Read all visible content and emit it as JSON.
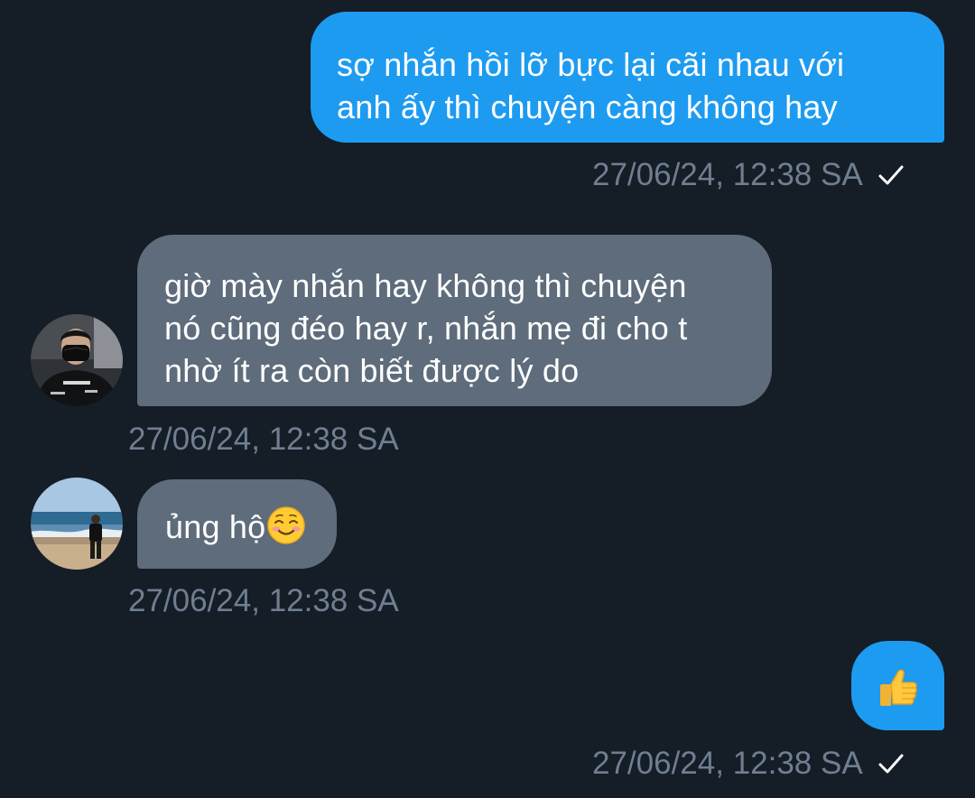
{
  "messages": [
    {
      "sender": "me",
      "lines": [
        "sợ nhắn hồi lỡ bực lại cãi nhau với",
        "anh ấy thì chuyện càng không hay"
      ],
      "time": "27/06/24, 12:38 SA",
      "status_icon": "check-icon"
    },
    {
      "sender": "other",
      "lines": [
        "giờ mày nhắn hay không thì chuyện",
        "nó cũng đéo hay r, nhắn mẹ đi cho t",
        "nhờ ít ra còn biết được lý do"
      ],
      "time": "27/06/24, 12:38 SA",
      "avatar_icon": "avatar-masked-person"
    },
    {
      "sender": "other",
      "text": "ủng hộ",
      "emoji_icon": "smiling-face-emoji",
      "time": "27/06/24, 12:38 SA",
      "avatar_icon": "avatar-beach-person"
    },
    {
      "sender": "me",
      "emoji_icon": "thumbs-up-emoji",
      "time": "27/06/24, 12:38 SA",
      "status_icon": "check-icon"
    }
  ],
  "colors": {
    "background": "#151d27",
    "outgoing_bubble": "#1d9bf0",
    "incoming_bubble": "#5e6c7b",
    "timestamp": "#6f7f91",
    "text": "#ffffff"
  }
}
